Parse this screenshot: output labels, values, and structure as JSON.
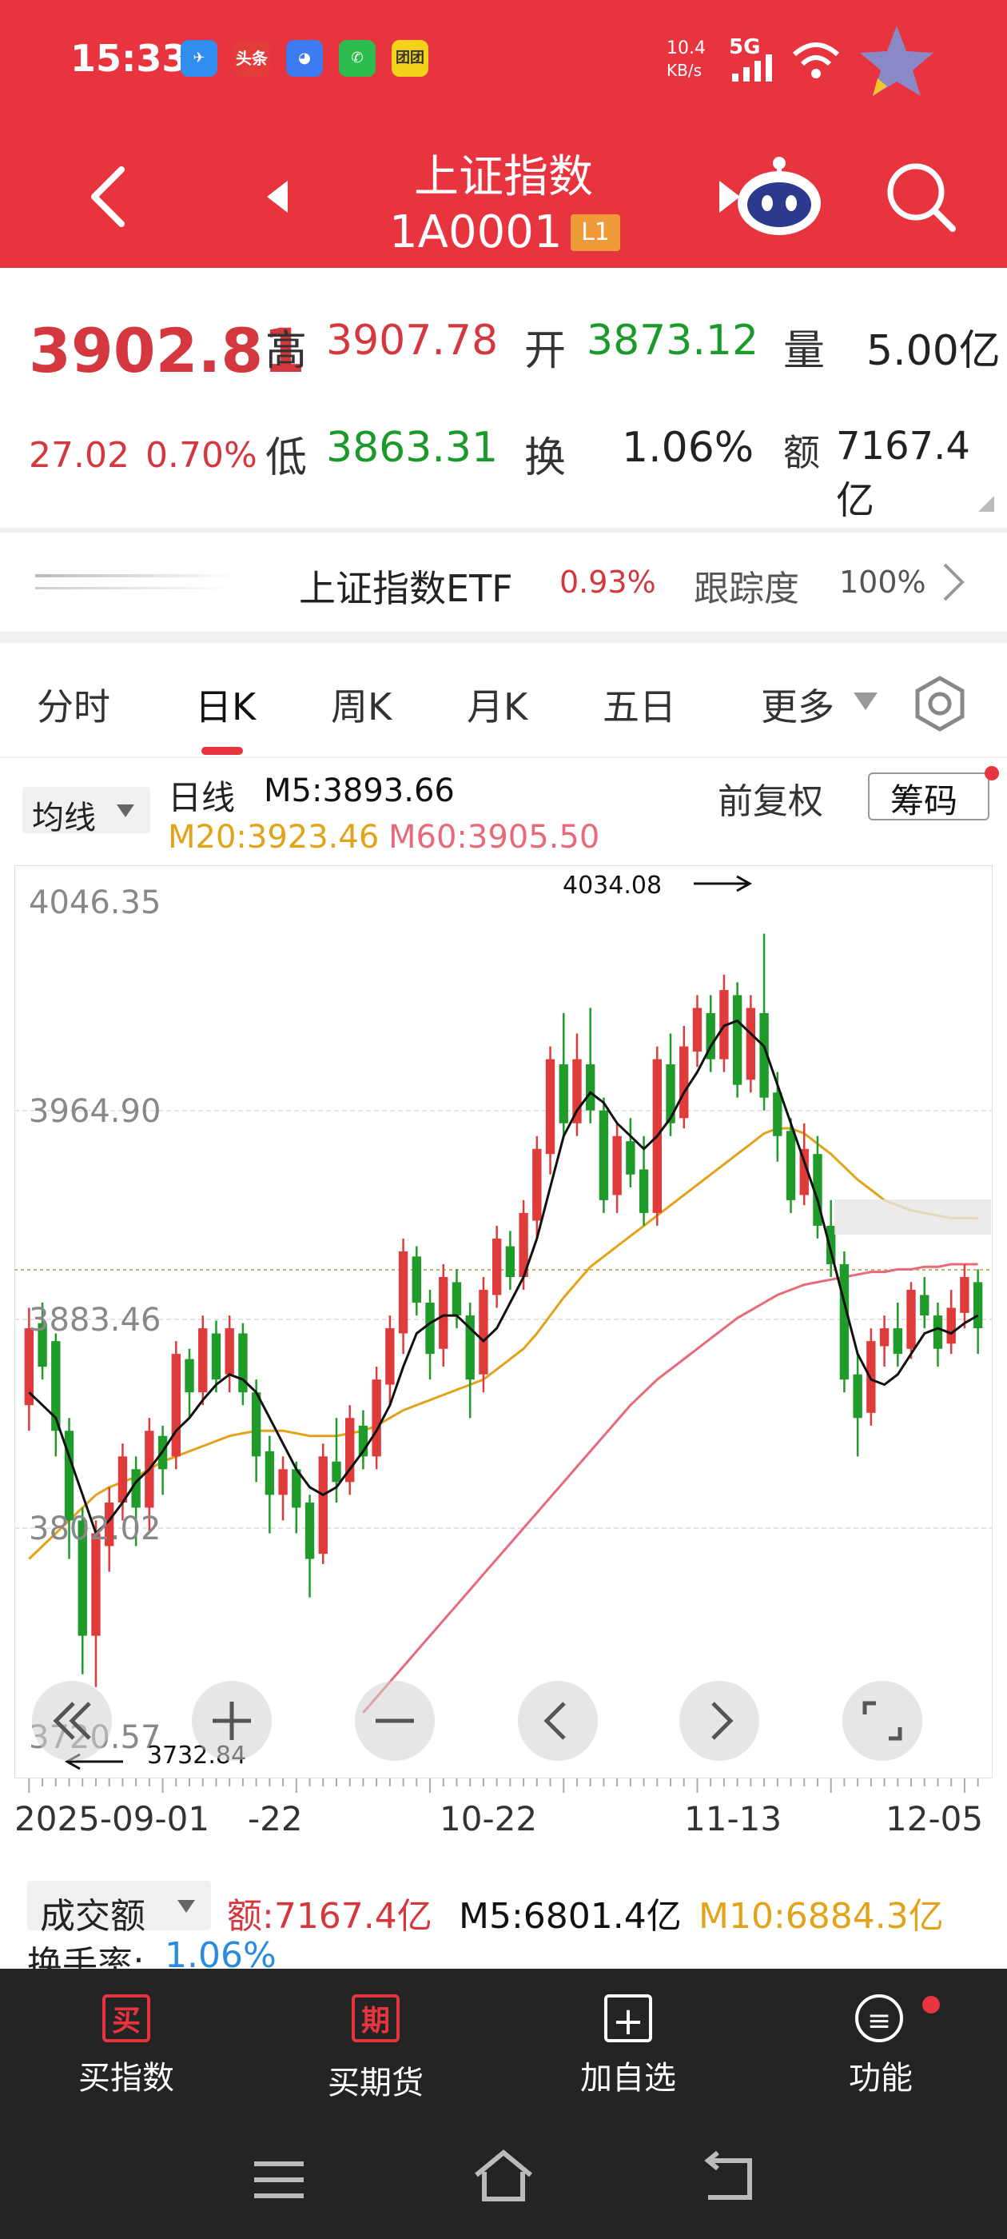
{
  "status_bar": {
    "time": "15:33",
    "net_speed": "10.4",
    "net_unit": "KB/s",
    "network": "5G",
    "apps": [
      "feishu",
      "头条",
      "browser",
      "wechat",
      "团团"
    ]
  },
  "header": {
    "title": "上证指数",
    "code": "1A0001",
    "badge": "L1"
  },
  "quote": {
    "price": "3902.81",
    "change": "27.02",
    "change_pct": "0.70%",
    "high_label": "高",
    "high": "3907.78",
    "open_label": "开",
    "open": "3873.12",
    "volume_label": "量",
    "volume": "5.00亿",
    "low_label": "低",
    "low": "3863.31",
    "turnover_label": "换",
    "turnover": "1.06%",
    "amount_label": "额",
    "amount": "7167.4亿"
  },
  "etf": {
    "name": "上证指数ETF",
    "change": "0.93%",
    "track_label": "跟踪度",
    "track": "100%"
  },
  "tabs": [
    "分时",
    "日K",
    "周K",
    "月K",
    "五日",
    "更多"
  ],
  "active_tab": "日K",
  "chart_header": {
    "ma_button": "均线",
    "period": "日线",
    "m5": "M5:3893.66",
    "m20": "M20:3923.46",
    "m60": "M60:3905.50",
    "adjust": "前复权",
    "chips": "筹码"
  },
  "chart_data": {
    "type": "candlestick",
    "y_ticks": [
      "4046.35",
      "3964.90",
      "3883.46",
      "3802.02",
      "3720.57"
    ],
    "ylim": [
      3720.57,
      4046.35
    ],
    "x_ticks": [
      "2025-09-01",
      "-22",
      "10-22",
      "11-13",
      "12-05"
    ],
    "max_label": "4034.08",
    "min_label": "3732.84",
    "series": [
      {
        "name": "M5",
        "color": "#111111"
      },
      {
        "name": "M20",
        "color": "#e2a21a"
      },
      {
        "name": "M60",
        "color": "#e86a7a"
      }
    ],
    "candles": [
      [
        3850,
        3880,
        3840,
        3888
      ],
      [
        3882,
        3865,
        3860,
        3890
      ],
      [
        3875,
        3840,
        3830,
        3878
      ],
      [
        3840,
        3805,
        3790,
        3845
      ],
      [
        3805,
        3760,
        3745,
        3810
      ],
      [
        3760,
        3800,
        3740,
        3805
      ],
      [
        3795,
        3812,
        3785,
        3818
      ],
      [
        3812,
        3830,
        3805,
        3835
      ],
      [
        3825,
        3810,
        3795,
        3830
      ],
      [
        3810,
        3840,
        3800,
        3845
      ],
      [
        3838,
        3825,
        3815,
        3842
      ],
      [
        3830,
        3870,
        3825,
        3875
      ],
      [
        3868,
        3855,
        3845,
        3872
      ],
      [
        3855,
        3880,
        3850,
        3885
      ],
      [
        3878,
        3860,
        3855,
        3883
      ],
      [
        3862,
        3880,
        3855,
        3885
      ],
      [
        3878,
        3855,
        3850,
        3882
      ],
      [
        3855,
        3830,
        3820,
        3860
      ],
      [
        3832,
        3815,
        3800,
        3838
      ],
      [
        3815,
        3825,
        3805,
        3830
      ],
      [
        3825,
        3810,
        3800,
        3828
      ],
      [
        3812,
        3790,
        3775,
        3815
      ],
      [
        3792,
        3830,
        3788,
        3835
      ],
      [
        3828,
        3820,
        3812,
        3845
      ],
      [
        3820,
        3845,
        3815,
        3850
      ],
      [
        3842,
        3830,
        3825,
        3848
      ],
      [
        3830,
        3860,
        3825,
        3865
      ],
      [
        3858,
        3880,
        3850,
        3885
      ],
      [
        3878,
        3910,
        3870,
        3915
      ],
      [
        3908,
        3890,
        3885,
        3912
      ],
      [
        3890,
        3870,
        3860,
        3895
      ],
      [
        3872,
        3900,
        3865,
        3905
      ],
      [
        3898,
        3885,
        3880,
        3903
      ],
      [
        3885,
        3860,
        3845,
        3890
      ],
      [
        3862,
        3895,
        3855,
        3900
      ],
      [
        3893,
        3915,
        3888,
        3920
      ],
      [
        3912,
        3900,
        3895,
        3918
      ],
      [
        3900,
        3925,
        3895,
        3930
      ],
      [
        3922,
        3950,
        3915,
        3955
      ],
      [
        3948,
        3985,
        3940,
        3990
      ],
      [
        3983,
        3960,
        3955,
        4003
      ],
      [
        3960,
        3985,
        3955,
        3995
      ],
      [
        3983,
        3965,
        3960,
        4005
      ],
      [
        3965,
        3930,
        3925,
        3970
      ],
      [
        3932,
        3955,
        3925,
        3960
      ],
      [
        3953,
        3940,
        3935,
        3962
      ],
      [
        3942,
        3925,
        3920,
        3955
      ],
      [
        3925,
        3985,
        3920,
        3990
      ],
      [
        3983,
        3960,
        3955,
        3995
      ],
      [
        3962,
        3990,
        3958,
        3998
      ],
      [
        3988,
        4005,
        3982,
        4010
      ],
      [
        4003,
        3985,
        3980,
        4010
      ],
      [
        3985,
        4012,
        3980,
        4018
      ],
      [
        4010,
        3975,
        3970,
        4015
      ],
      [
        3977,
        4005,
        3972,
        4010
      ],
      [
        4003,
        3970,
        3965,
        4034
      ],
      [
        3972,
        3955,
        3945,
        3980
      ],
      [
        3957,
        3930,
        3925,
        3962
      ],
      [
        3932,
        3950,
        3928,
        3960
      ],
      [
        3948,
        3920,
        3915,
        3955
      ],
      [
        3920,
        3905,
        3900,
        3930
      ],
      [
        3905,
        3860,
        3855,
        3910
      ],
      [
        3862,
        3845,
        3830,
        3870
      ],
      [
        3847,
        3875,
        3842,
        3880
      ],
      [
        3873,
        3880,
        3865,
        3885
      ],
      [
        3880,
        3870,
        3865,
        3890
      ],
      [
        3872,
        3895,
        3868,
        3898
      ],
      [
        3893,
        3885,
        3880,
        3900
      ],
      [
        3885,
        3872,
        3865,
        3890
      ],
      [
        3874,
        3888,
        3870,
        3895
      ],
      [
        3886,
        3900,
        3880,
        3905
      ],
      [
        3898,
        3880,
        3870,
        3903
      ]
    ],
    "m5": [
      3855,
      3850,
      3845,
      3830,
      3815,
      3800,
      3805,
      3812,
      3820,
      3825,
      3832,
      3840,
      3845,
      3852,
      3858,
      3862,
      3860,
      3855,
      3845,
      3835,
      3825,
      3818,
      3815,
      3818,
      3825,
      3832,
      3840,
      3850,
      3865,
      3878,
      3882,
      3885,
      3885,
      3880,
      3875,
      3880,
      3890,
      3900,
      3915,
      3935,
      3955,
      3965,
      3972,
      3968,
      3960,
      3955,
      3950,
      3955,
      3962,
      3972,
      3980,
      3990,
      3998,
      4000,
      3995,
      3990,
      3975,
      3960,
      3945,
      3930,
      3910,
      3890,
      3870,
      3860,
      3858,
      3862,
      3870,
      3878,
      3880,
      3878,
      3882,
      3885
    ],
    "m20": [
      3790,
      3795,
      3800,
      3805,
      3810,
      3815,
      3818,
      3820,
      3822,
      3825,
      3828,
      3830,
      3832,
      3834,
      3836,
      3838,
      3839,
      3840,
      3840,
      3840,
      3839,
      3838,
      3838,
      3838,
      3839,
      3840,
      3842,
      3845,
      3848,
      3850,
      3852,
      3854,
      3856,
      3858,
      3860,
      3864,
      3868,
      3872,
      3878,
      3885,
      3892,
      3898,
      3904,
      3908,
      3912,
      3916,
      3920,
      3924,
      3928,
      3932,
      3936,
      3940,
      3944,
      3948,
      3952,
      3956,
      3958,
      3958,
      3956,
      3952,
      3948,
      3943,
      3938,
      3934,
      3930,
      3928,
      3926,
      3925,
      3924,
      3923,
      3923,
      3923
    ],
    "m60": [
      null,
      null,
      null,
      null,
      null,
      null,
      null,
      null,
      null,
      null,
      null,
      null,
      null,
      null,
      null,
      null,
      null,
      null,
      null,
      null,
      null,
      null,
      null,
      null,
      null,
      3730,
      3736,
      3742,
      3748,
      3754,
      3760,
      3766,
      3772,
      3778,
      3784,
      3790,
      3796,
      3802,
      3808,
      3814,
      3820,
      3826,
      3832,
      3838,
      3844,
      3850,
      3855,
      3860,
      3864,
      3868,
      3872,
      3876,
      3880,
      3884,
      3887,
      3890,
      3893,
      3895,
      3897,
      3898,
      3899,
      3900,
      3901,
      3902,
      3902,
      3903,
      3903,
      3904,
      3904,
      3905,
      3905,
      3905
    ]
  },
  "volume": {
    "label": "成交额",
    "amount": "额:7167.4亿",
    "m5": "M5:6801.4亿",
    "m10": "M10:6884.3亿",
    "turnover_label": "换手率:",
    "turnover": "1.06%"
  },
  "bottom_nav": [
    {
      "icon": "买",
      "label": "买指数"
    },
    {
      "icon": "期",
      "label": "买期货"
    },
    {
      "icon": "+",
      "label": "加自选"
    },
    {
      "icon": "≡",
      "label": "功能"
    }
  ]
}
